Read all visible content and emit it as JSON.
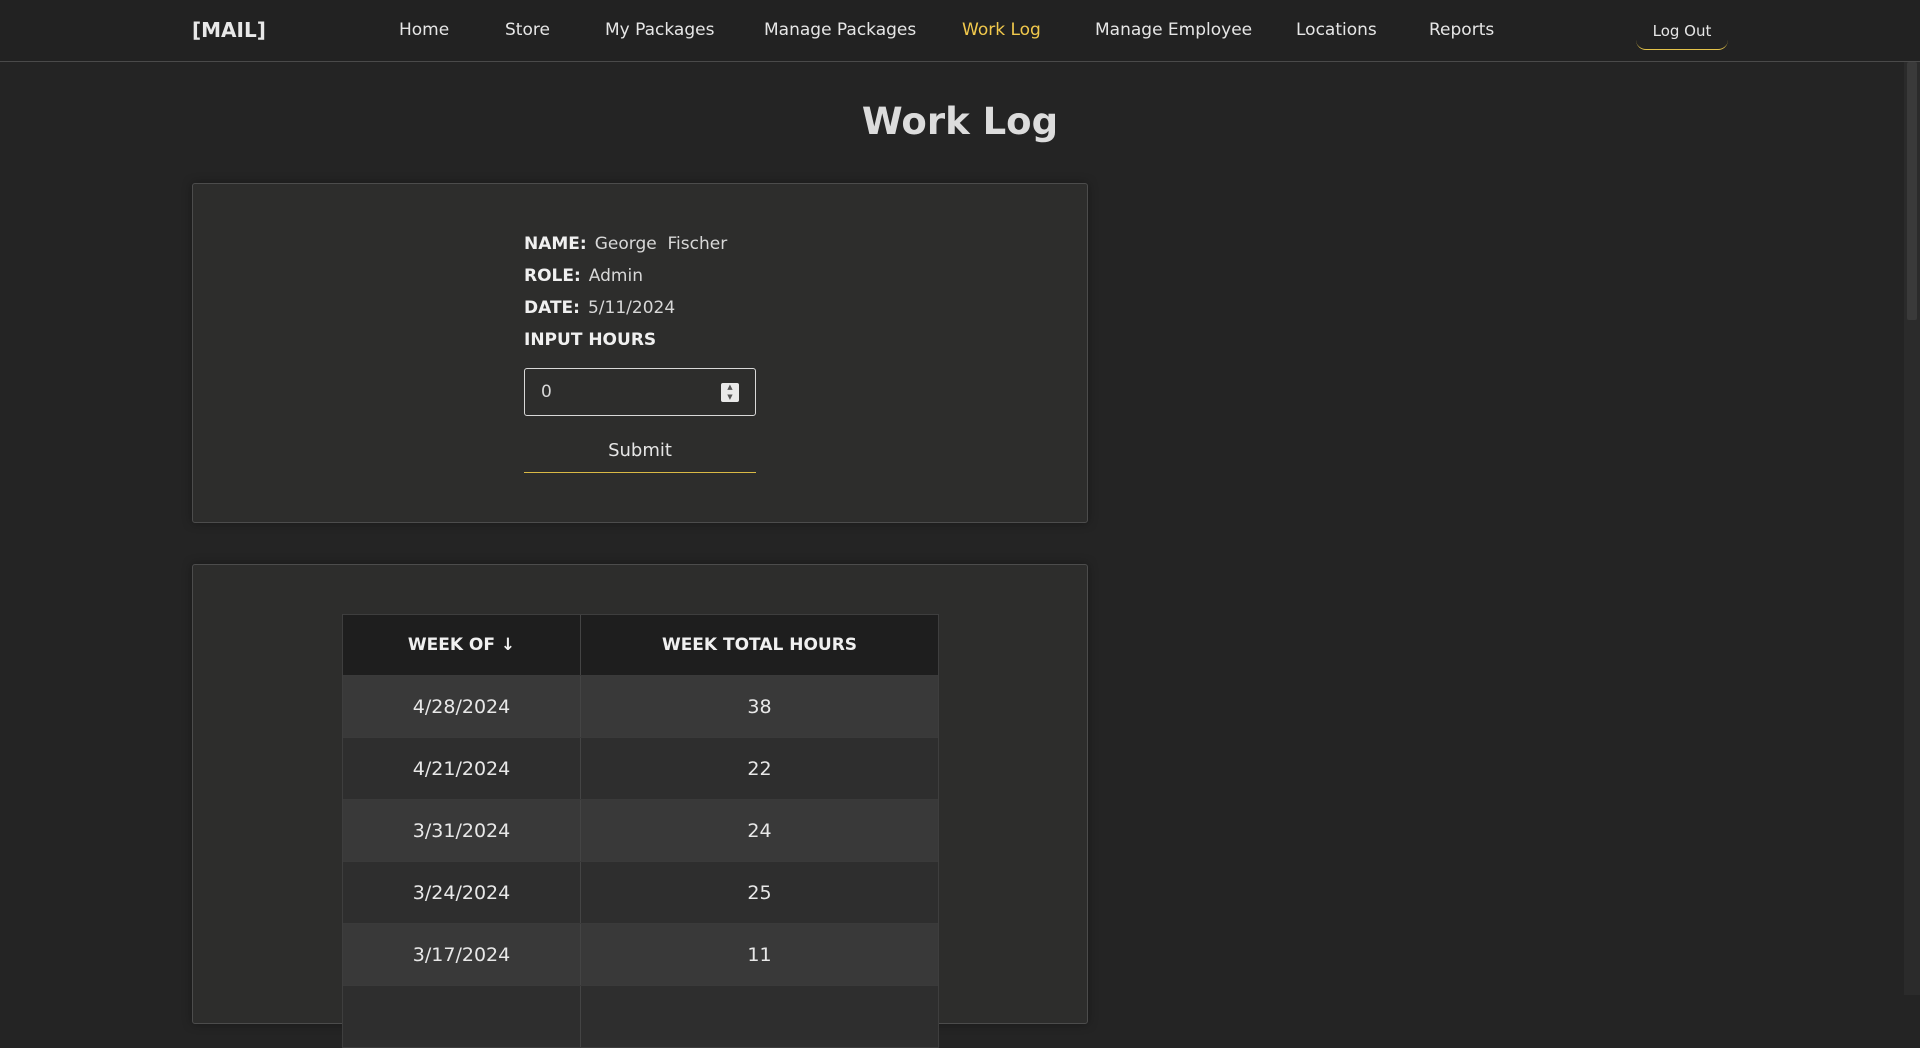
{
  "brand": "[MAIL]",
  "nav": [
    {
      "label": "Home",
      "active": false
    },
    {
      "label": "Store",
      "active": false
    },
    {
      "label": "My Packages",
      "active": false
    },
    {
      "label": "Manage Packages",
      "active": false
    },
    {
      "label": "Work Log",
      "active": true
    },
    {
      "label": "Manage Employee",
      "active": false
    },
    {
      "label": "Locations",
      "active": false
    },
    {
      "label": "Reports",
      "active": false
    }
  ],
  "logout_label": "Log Out",
  "page_title": "Work Log",
  "form": {
    "name_label": "NAME:",
    "name_value": "George  Fischer",
    "role_label": "ROLE:",
    "role_value": "Admin",
    "date_label": "DATE:",
    "date_value": "5/11/2024",
    "hours_label": "INPUT HOURS",
    "hours_value": "0",
    "submit_label": "Submit"
  },
  "table": {
    "headers": [
      "WEEK OF ↓",
      "WEEK TOTAL HOURS"
    ],
    "rows": [
      [
        "4/28/2024",
        "38"
      ],
      [
        "4/21/2024",
        "22"
      ],
      [
        "3/31/2024",
        "24"
      ],
      [
        "3/24/2024",
        "25"
      ],
      [
        "3/17/2024",
        "11"
      ]
    ]
  },
  "colors": {
    "accent": "#f2c94c",
    "background": "#242424",
    "card": "#2d2d2c"
  }
}
